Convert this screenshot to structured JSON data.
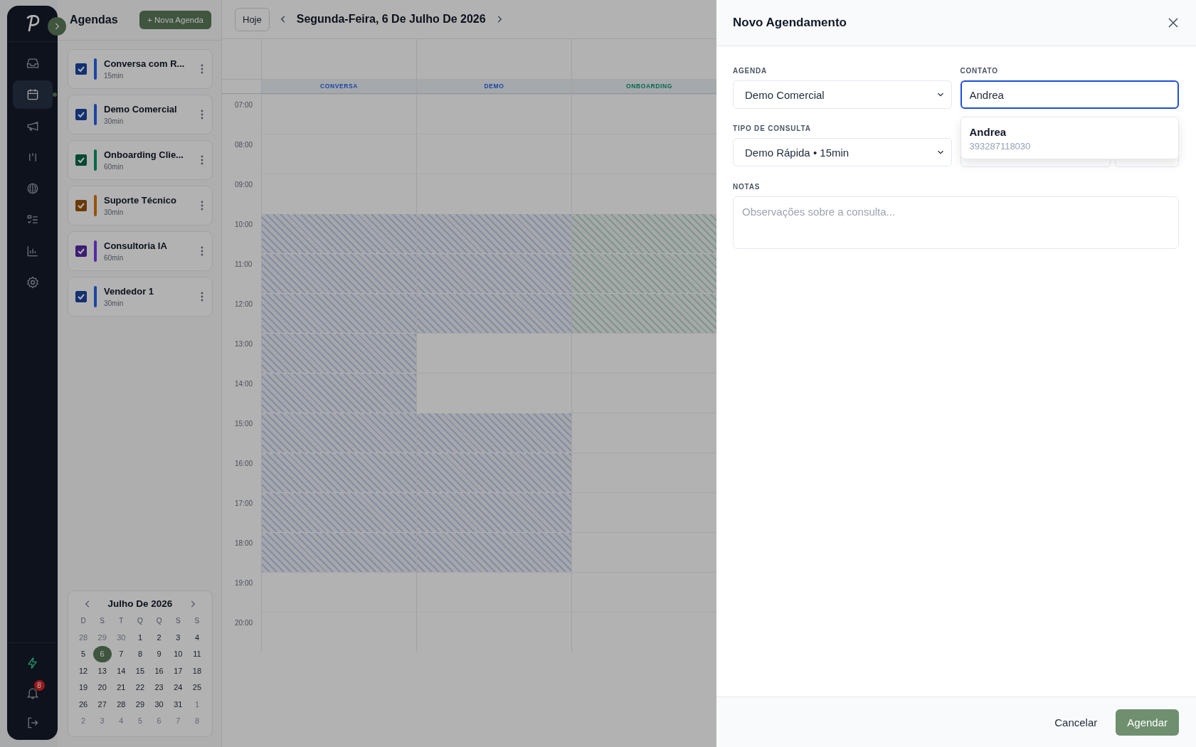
{
  "nav": {
    "items": [
      {
        "kind": "inbox",
        "selected": false
      },
      {
        "kind": "calendar",
        "selected": true
      },
      {
        "kind": "megaphone",
        "selected": false
      },
      {
        "kind": "kanban",
        "selected": false
      },
      {
        "kind": "brain",
        "selected": false
      },
      {
        "kind": "checklist",
        "selected": false
      },
      {
        "kind": "chart",
        "selected": false
      },
      {
        "kind": "settings",
        "selected": false
      }
    ],
    "bottom": [
      {
        "kind": "bolt"
      },
      {
        "kind": "bell",
        "badge": "8"
      },
      {
        "kind": "logout"
      }
    ]
  },
  "agendas": {
    "title": "Agendas",
    "new_button": "+ Nova Agenda",
    "items": [
      {
        "name": "Conversa com R...",
        "duration": "15min",
        "checked": true,
        "color": "#1a45a4"
      },
      {
        "name": "Demo Comercial",
        "duration": "30min",
        "checked": true,
        "color": "#1a45a4"
      },
      {
        "name": "Onboarding Clie...",
        "duration": "60min",
        "checked": true,
        "color": "#03694a"
      },
      {
        "name": "Suporte Técnico",
        "duration": "30min",
        "checked": true,
        "color": "#985304"
      },
      {
        "name": "Consultoria IA",
        "duration": "60min",
        "checked": true,
        "color": "#5729a6"
      },
      {
        "name": "Vendedor 1",
        "duration": "30min",
        "checked": true,
        "color": "#1a45a4"
      }
    ]
  },
  "mini_calendar": {
    "title": "Julho De 2026",
    "weekdays": [
      "D",
      "S",
      "T",
      "Q",
      "Q",
      "S",
      "S"
    ],
    "days": [
      {
        "label": "28",
        "muted": true,
        "selected": false
      },
      {
        "label": "29",
        "muted": true,
        "selected": false
      },
      {
        "label": "30",
        "muted": true,
        "selected": false
      },
      {
        "label": "1",
        "muted": false,
        "selected": false
      },
      {
        "label": "2",
        "muted": false,
        "selected": false
      },
      {
        "label": "3",
        "muted": false,
        "selected": false
      },
      {
        "label": "4",
        "muted": false,
        "selected": false
      },
      {
        "label": "5",
        "muted": false,
        "selected": false
      },
      {
        "label": "6",
        "muted": false,
        "selected": true
      },
      {
        "label": "7",
        "muted": false,
        "selected": false
      },
      {
        "label": "8",
        "muted": false,
        "selected": false
      },
      {
        "label": "9",
        "muted": false,
        "selected": false
      },
      {
        "label": "10",
        "muted": false,
        "selected": false
      },
      {
        "label": "11",
        "muted": false,
        "selected": false
      },
      {
        "label": "12",
        "muted": false,
        "selected": false
      },
      {
        "label": "13",
        "muted": false,
        "selected": false
      },
      {
        "label": "14",
        "muted": false,
        "selected": false
      },
      {
        "label": "15",
        "muted": false,
        "selected": false
      },
      {
        "label": "16",
        "muted": false,
        "selected": false
      },
      {
        "label": "17",
        "muted": false,
        "selected": false
      },
      {
        "label": "18",
        "muted": false,
        "selected": false
      },
      {
        "label": "19",
        "muted": false,
        "selected": false
      },
      {
        "label": "20",
        "muted": false,
        "selected": false
      },
      {
        "label": "21",
        "muted": false,
        "selected": false
      },
      {
        "label": "22",
        "muted": false,
        "selected": false
      },
      {
        "label": "23",
        "muted": false,
        "selected": false
      },
      {
        "label": "24",
        "muted": false,
        "selected": false
      },
      {
        "label": "25",
        "muted": false,
        "selected": false
      },
      {
        "label": "26",
        "muted": false,
        "selected": false
      },
      {
        "label": "27",
        "muted": false,
        "selected": false
      },
      {
        "label": "28",
        "muted": false,
        "selected": false
      },
      {
        "label": "29",
        "muted": false,
        "selected": false
      },
      {
        "label": "30",
        "muted": false,
        "selected": false
      },
      {
        "label": "31",
        "muted": false,
        "selected": false
      },
      {
        "label": "1",
        "muted": true,
        "selected": false
      },
      {
        "label": "2",
        "muted": true,
        "selected": false
      },
      {
        "label": "3",
        "muted": true,
        "selected": false
      },
      {
        "label": "4",
        "muted": true,
        "selected": false
      },
      {
        "label": "5",
        "muted": true,
        "selected": false
      },
      {
        "label": "6",
        "muted": true,
        "selected": false
      },
      {
        "label": "7",
        "muted": true,
        "selected": false
      },
      {
        "label": "8",
        "muted": true,
        "selected": false
      }
    ]
  },
  "day_view": {
    "today_button": "Hoje",
    "date_title": "Segunda-Feira, 6 De Julho De 2026",
    "columns": [
      {
        "label": "CONVERSA",
        "color": "#1a45a4"
      },
      {
        "label": "DEMO",
        "color": "#1a45a4"
      },
      {
        "label": "ONBOARDING",
        "color": "#03694a"
      }
    ],
    "hours": [
      {
        "time": "07:00",
        "blocked": [
          false,
          false,
          false
        ]
      },
      {
        "time": "08:00",
        "blocked": [
          false,
          false,
          false
        ]
      },
      {
        "time": "09:00",
        "blocked": [
          false,
          false,
          false
        ]
      },
      {
        "time": "10:00",
        "blocked": [
          true,
          true,
          true
        ]
      },
      {
        "time": "11:00",
        "blocked": [
          true,
          true,
          true
        ]
      },
      {
        "time": "12:00",
        "blocked": [
          true,
          true,
          true
        ]
      },
      {
        "time": "13:00",
        "blocked": [
          true,
          false,
          false
        ]
      },
      {
        "time": "14:00",
        "blocked": [
          true,
          false,
          false
        ]
      },
      {
        "time": "15:00",
        "blocked": [
          true,
          true,
          false
        ]
      },
      {
        "time": "16:00",
        "blocked": [
          true,
          true,
          false
        ]
      },
      {
        "time": "17:00",
        "blocked": [
          true,
          true,
          false
        ]
      },
      {
        "time": "18:00",
        "blocked": [
          true,
          true,
          false
        ]
      },
      {
        "time": "19:00",
        "blocked": [
          false,
          false,
          false
        ]
      },
      {
        "time": "20:00",
        "blocked": [
          false,
          false,
          false
        ]
      }
    ]
  },
  "modal": {
    "title": "Novo Agendamento",
    "agenda": {
      "label": "AGENDA",
      "value": "Demo Comercial"
    },
    "contact": {
      "label": "CONTATO",
      "value": "Andrea",
      "suggestions": [
        {
          "name": "Andrea",
          "phone": "393287118030"
        }
      ]
    },
    "consult_type": {
      "label": "TIPO DE CONSULTA",
      "value": "Demo Rápida • 15min"
    },
    "notes": {
      "label": "NOTAS",
      "placeholder": "Observações sobre a consulta..."
    },
    "cancel_button": "Cancelar",
    "submit_button": "Agendar"
  }
}
